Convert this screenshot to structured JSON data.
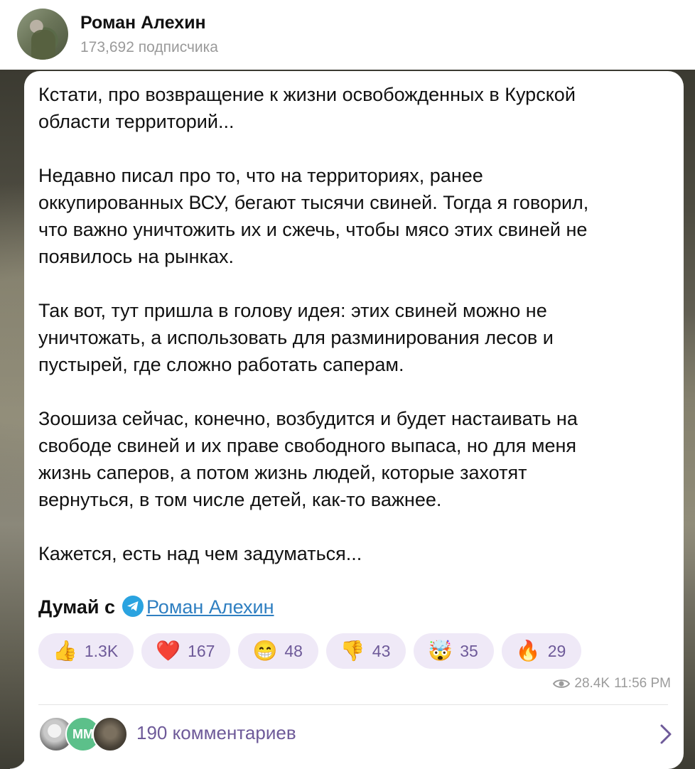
{
  "channel": {
    "name": "Роман Алехин",
    "subscribers": "173,692 подписчика"
  },
  "post": {
    "text": "Кстати, про возвращение к жизни освобожденных в Курской\nобласти территорий...\n\nНедавно писал про то, что на территориях, ранее\nоккупированных ВСУ, бегают тысячи свиней. Тогда я говорил,\nчто важно уничтожить их и сжечь, чтобы мясо этих свиней не\nпоявилось на рынках.\n\nТак вот, тут пришла в голову идея: этих свиней можно не\nуничтожать, а использовать для разминирования лесов и\nпустырей, где сложно работать саперам.\n\nЗоошиза сейчас, конечно, возбудится и будет настаивать на\nсвободе свиней и их праве свободного выпаса, но для меня\nжизнь саперов, а потом жизнь людей, которые захотят\nвернуться, в том числе детей, как-то важнее.\n\nКажется, есть над чем задуматься...",
    "signature_prefix": "Думай с",
    "signature_link": "Роман Алехин"
  },
  "reactions": [
    {
      "emoji": "👍",
      "count": "1.3K"
    },
    {
      "emoji": "❤️",
      "count": "167"
    },
    {
      "emoji": "😁",
      "count": "48"
    },
    {
      "emoji": "👎",
      "count": "43"
    },
    {
      "emoji": "🤯",
      "count": "35"
    },
    {
      "emoji": "🔥",
      "count": "29"
    }
  ],
  "meta": {
    "views": "28.4K",
    "time": "11:56 PM"
  },
  "comments": {
    "label": "190 комментариев",
    "avatar_initials": "MM"
  },
  "colors": {
    "accent": "#6e5a99",
    "reaction_bg": "#efe9f7",
    "link": "#2f7fc1",
    "telegram": "#2aa3e0"
  }
}
